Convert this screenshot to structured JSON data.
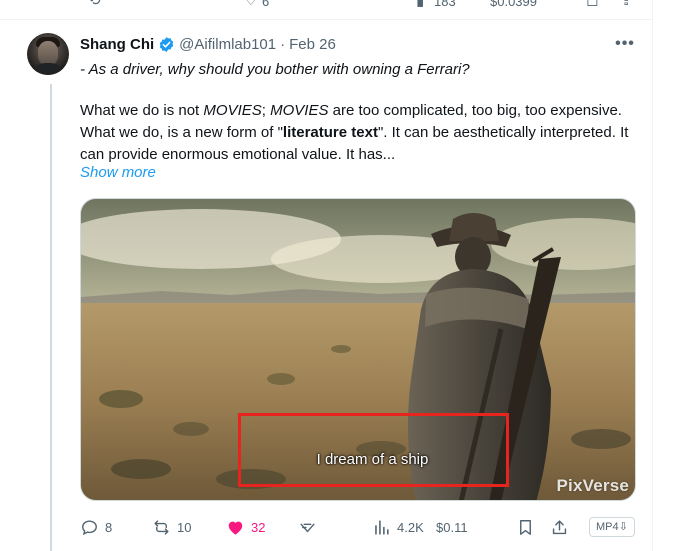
{
  "prev_row": {
    "reply_icon": "reply-icon",
    "like_count": "6",
    "views_count": "183",
    "money": "$0.0399"
  },
  "tweet": {
    "author_name": "Shang Chi",
    "verified_icon": "verified-badge-icon",
    "handle": "@Aifilmlab101",
    "separator": "·",
    "date": "Feb 26",
    "more_label": "•••",
    "first_line": "- As a driver, why should you bother with owning a Ferrari?",
    "body": {
      "part1": "What we do is not ",
      "movies1": "MOVIES",
      "part2": "; ",
      "movies2": "MOVIES",
      "part3": " are too complicated, too big, too expensive. What we do, is a new form of \"",
      "literature": "literature text",
      "part4": "\". It can be aesthetically interpreted. It can provide enormous emotional value. It has..."
    },
    "show_more": "Show more",
    "media": {
      "subtitle": "I dream of a ship",
      "watermark": "PixVerse",
      "highlight_color": "#e8241f"
    },
    "actions": {
      "replies": "8",
      "retweets": "10",
      "likes": "32",
      "views": "4.2K",
      "tip": "$0.11",
      "mp4_label": "MP4⇩"
    }
  },
  "colors": {
    "accent": "#1d9bf0",
    "like": "#f91880",
    "muted": "#536471",
    "text": "#0f1419"
  }
}
